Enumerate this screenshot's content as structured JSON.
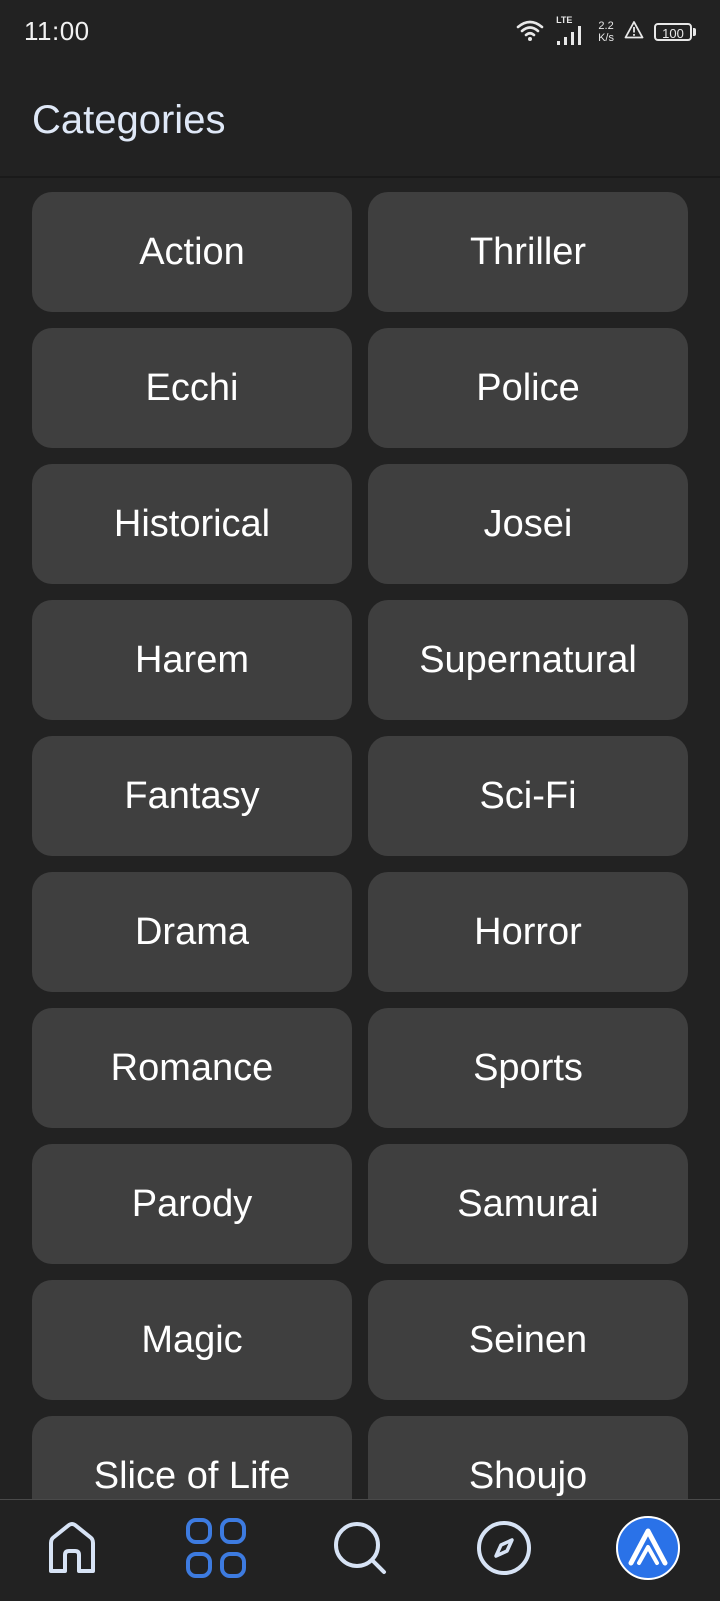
{
  "status_bar": {
    "time": "11:00",
    "network_type": "LTE",
    "speed_value": "2.2",
    "speed_unit": "K/s",
    "battery": "100",
    "icons": [
      "wifi-icon",
      "signal-icon",
      "warning-icon",
      "battery-icon"
    ]
  },
  "header": {
    "title": "Categories"
  },
  "categories": [
    "Action",
    "Thriller",
    "Ecchi",
    "Police",
    "Historical",
    "Josei",
    "Harem",
    "Supernatural",
    "Fantasy",
    "Sci-Fi",
    "Drama",
    "Horror",
    "Romance",
    "Sports",
    "Parody",
    "Samurai",
    "Magic",
    "Seinen",
    "Slice of Life",
    "Shoujo"
  ],
  "bottom_nav": {
    "items": [
      {
        "icon": "home-icon",
        "active": false
      },
      {
        "icon": "categories-grid-icon",
        "active": true
      },
      {
        "icon": "search-icon",
        "active": false
      },
      {
        "icon": "compass-icon",
        "active": false
      },
      {
        "icon": "app-logo-icon",
        "active": false
      }
    ]
  },
  "colors": {
    "background": "#222222",
    "tile": "#3f3f3f",
    "accent": "#3d7be0",
    "title": "#dfe8f7",
    "icon": "#d7e3f5"
  }
}
